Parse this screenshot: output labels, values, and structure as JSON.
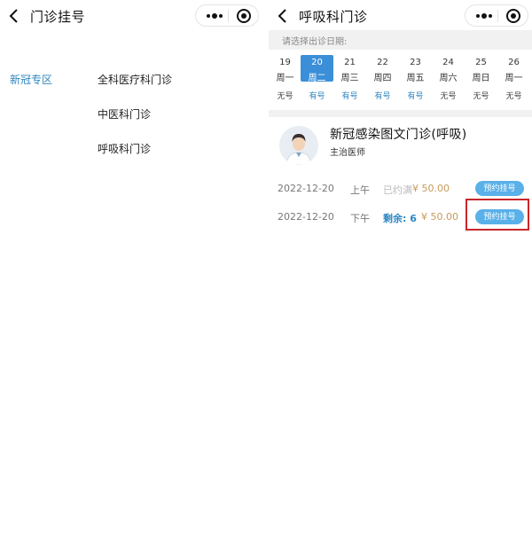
{
  "left_screen": {
    "title": "门诊挂号",
    "sidebar": {
      "items": [
        {
          "label": "新冠专区",
          "active": true
        }
      ]
    },
    "clinics": [
      {
        "label": "全科医疗科门诊"
      },
      {
        "label": "中医科门诊"
      },
      {
        "label": "呼吸科门诊"
      }
    ]
  },
  "right_screen": {
    "title": "呼吸科门诊",
    "date_hint": "请选择出诊日期:",
    "dates": [
      {
        "day": "19",
        "weekday": "周一",
        "availability": "无号",
        "selected": false
      },
      {
        "day": "20",
        "weekday": "周二",
        "availability": "有号",
        "selected": true
      },
      {
        "day": "21",
        "weekday": "周三",
        "availability": "有号",
        "selected": false
      },
      {
        "day": "22",
        "weekday": "周四",
        "availability": "有号",
        "selected": false
      },
      {
        "day": "23",
        "weekday": "周五",
        "availability": "有号",
        "selected": false
      },
      {
        "day": "24",
        "weekday": "周六",
        "availability": "无号",
        "selected": false
      },
      {
        "day": "25",
        "weekday": "周日",
        "availability": "无号",
        "selected": false
      },
      {
        "day": "26",
        "weekday": "周一",
        "availability": "无号",
        "selected": false
      }
    ],
    "doctor": {
      "name": "新冠感染图文门诊(呼吸)",
      "title": "主治医师"
    },
    "slots": [
      {
        "date": "2022-12-20",
        "period": "上午",
        "status": "已约满",
        "price": "¥ 50.00",
        "button": "预约挂号"
      },
      {
        "date": "2022-12-20",
        "period": "下午",
        "status": "剩余: 6",
        "price": "¥ 50.00",
        "button": "预约挂号"
      }
    ]
  },
  "colors": {
    "accent": "#3b8fd8",
    "link": "#2e86c1",
    "price": "#c89b5b",
    "button": "#5ab0e8",
    "highlight": "#c8262b"
  },
  "icons": {
    "back": "chevron-left-icon",
    "more": "more-dots-icon",
    "close": "target-circle-icon",
    "avatar": "doctor-avatar-icon"
  }
}
